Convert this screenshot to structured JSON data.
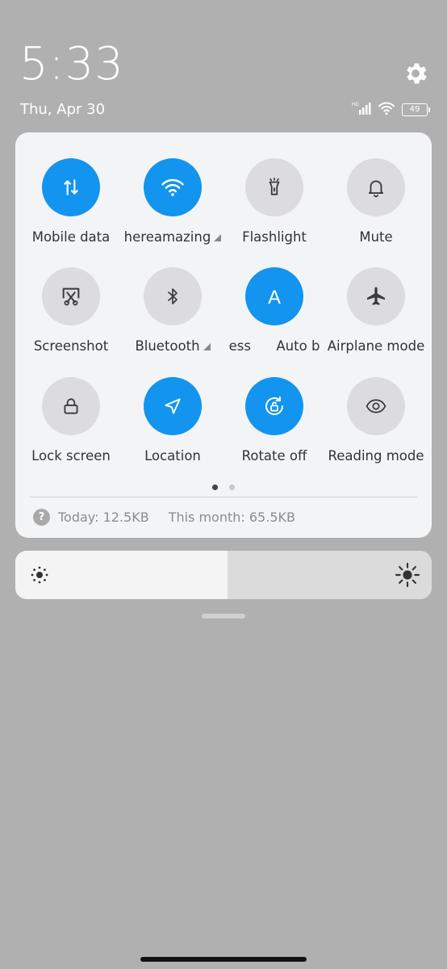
{
  "status": {
    "time": "5:33",
    "date": "Thu, Apr 30",
    "battery": "49",
    "network": "HD"
  },
  "tiles": [
    {
      "label": "Mobile data",
      "icon": "mobile-data-icon",
      "on": true
    },
    {
      "label": "hereamazing",
      "icon": "wifi-icon",
      "on": true,
      "has_arrow": true
    },
    {
      "label": "Flashlight",
      "icon": "flashlight-icon",
      "on": false
    },
    {
      "label": "Mute",
      "icon": "bell-icon",
      "on": false
    },
    {
      "label": "Screenshot",
      "icon": "screenshot-icon",
      "on": false
    },
    {
      "label": "Bluetooth",
      "icon": "bluetooth-icon",
      "on": false,
      "has_arrow": true
    },
    {
      "label": "ess      Auto b",
      "icon": "auto-brightness-icon",
      "on": true
    },
    {
      "label": "Airplane mode",
      "icon": "airplane-icon",
      "on": false
    },
    {
      "label": "Lock screen",
      "icon": "lock-icon",
      "on": false
    },
    {
      "label": "Location",
      "icon": "location-icon",
      "on": true
    },
    {
      "label": "Rotate off",
      "icon": "rotate-lock-icon",
      "on": true
    },
    {
      "label": "Reading mode",
      "icon": "eye-icon",
      "on": false
    }
  ],
  "usage": {
    "today": "Today: 12.5KB",
    "month": "This month: 65.5KB"
  },
  "brightness": {
    "level": 0.51
  },
  "colors": {
    "accent": "#1394ee",
    "tile_off": "#dcdcdf",
    "panel": "#f3f4f6",
    "backdrop": "#b0b0b0"
  }
}
